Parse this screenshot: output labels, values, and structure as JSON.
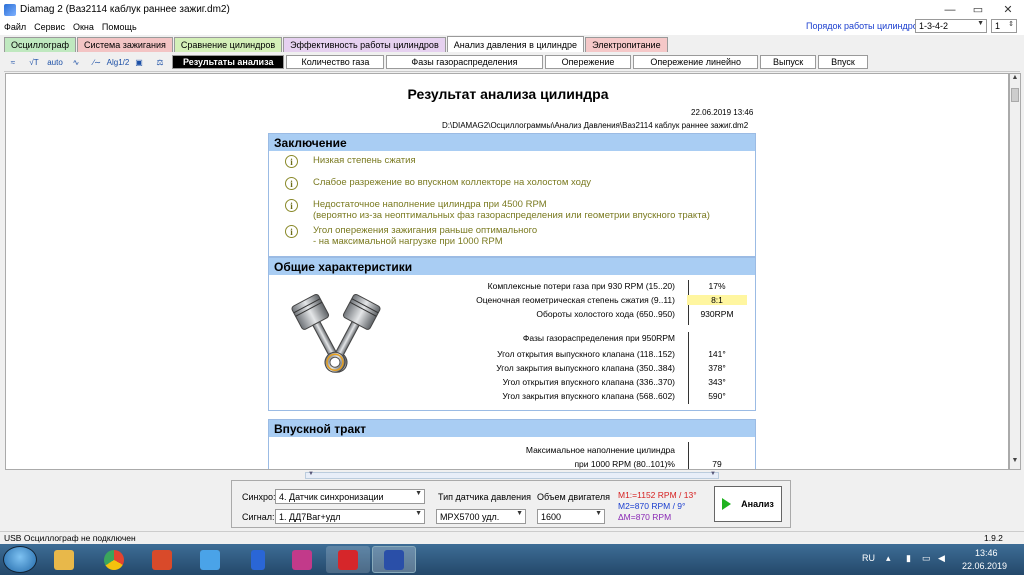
{
  "window": {
    "title": "Diamag 2 (Ваз2114 каблук раннее зажиг.dm2)"
  },
  "menu": [
    "Файл",
    "Сервис",
    "Окна",
    "Помощь"
  ],
  "cylinder_order": {
    "label": "Порядок работы цилиндров",
    "value": "1-3-4-2",
    "number": "1"
  },
  "main_tabs": [
    "Осциллограф",
    "Система зажигания",
    "Сравнение цилиндров",
    "Эффективность работы цилиндров",
    "Анализ давления в цилиндре",
    "Электропитание"
  ],
  "main_tab_colors": [
    "#bfe8bf",
    "#f3c4c4",
    "#d4f0b8",
    "#e6d1f0",
    "#ffffff",
    "#f5c8c8"
  ],
  "toolbar_icons": [
    "curve-icon",
    "chart-icon",
    "auto-icon",
    "wave-icon",
    "trend-icon",
    "algo-icon",
    "save-icon",
    "compare-icon"
  ],
  "toolbar_icon_text": [
    "≈",
    "√T",
    "auto",
    "∿",
    "∕∼",
    "Alg1/2",
    "▣",
    "⚖"
  ],
  "sub_tabs": [
    "Результаты анализа",
    "Количество газа",
    "Фазы газораспределения",
    "Опережение",
    "Опережение линейно",
    "Выпуск",
    "Впуск"
  ],
  "report": {
    "title": "Результат анализа цилиндра",
    "date": "22.06.2019 13:46",
    "path": "D:\\DIAMAG2\\Осциллограммы\\Анализ Давления\\Ваз2114 каблук раннее зажиг.dm2",
    "conclusion_title": "Заключение",
    "conclusions": [
      {
        "line1": "Низкая степень сжатия",
        "line2": ""
      },
      {
        "line1": "Слабое разрежение во впускном коллекторе на холостом ходу",
        "line2": ""
      },
      {
        "line1": "Недостаточное наполнение цилиндра при 4500 RPM",
        "line2": "(вероятно из-за неоптимальных фаз газораспределения или геометрии впускного тракта)"
      },
      {
        "line1": "Угол опережения зажигания раньше оптимального",
        "line2": "- на максимальной нагрузке при 1000 RPM"
      }
    ],
    "general_title": "Общие характеристики",
    "general_rows": [
      {
        "label": "Комплексные потери газа при 930 RPM (15..20)",
        "value": "17%"
      },
      {
        "label": "Оценочная геометрическая степень сжатия (9..11)",
        "value": "8:1"
      },
      {
        "label": "Обороты холостого хода (650..950)",
        "value": "930RPM"
      },
      {
        "label": "Фазы газораспределения при 950RPM",
        "value": ""
      },
      {
        "label": "Угол открытия выпускного клапана (118..152)",
        "value": "141°"
      },
      {
        "label": "Угол закрытия выпускного клапана (350..384)",
        "value": "378°"
      },
      {
        "label": "Угол открытия впускного клапана (336..370)",
        "value": "343°"
      },
      {
        "label": "Угол закрытия впускного клапана (568..602)",
        "value": "590°"
      }
    ],
    "intake_title": "Впускной тракт",
    "intake_rows": [
      {
        "label": "Максимальное наполнение цилиндра",
        "value": ""
      },
      {
        "label": "при 1000 RPM (80..101)%",
        "value": "79"
      }
    ]
  },
  "panel": {
    "sync_label": "Синхро:",
    "sync_value": "4. Датчик синхронизации",
    "signal_label": "Сигнал:",
    "signal_value": "1. ДД7Ваг+удл",
    "sensor_label": "Тип датчика давления",
    "sensor_value": "MPX5700 удл.",
    "volume_label": "Объем двигателя",
    "volume_value": "1600",
    "m1": "M1:=1152 RPM / 13°",
    "m2": "M2=870 RPM / 9°",
    "dm": "ΔM=870 RPM",
    "m1_color": "#d62020",
    "m2_color": "#1a3ecf",
    "dm_color": "#8a2ab5",
    "analyze_label": "Анализ"
  },
  "status": {
    "left": "USB Осциллограф не подключен",
    "version": "1.9.2"
  },
  "taskbar": {
    "apps": [
      "explorer-icon",
      "chrome-icon",
      "media-player-icon",
      "speaker-icon",
      "bluetooth-icon",
      "archiver-icon",
      "pdf-icon",
      "diamag-icon"
    ],
    "app_colors": [
      "#e8b84a",
      "#e3442f",
      "#d94a2a",
      "#4aa3e8",
      "#2a66d6",
      "#c23a8a",
      "#d6262a",
      "#2a4fa8"
    ],
    "lang": "RU",
    "time": "13:46",
    "date": "22.06.2019"
  }
}
